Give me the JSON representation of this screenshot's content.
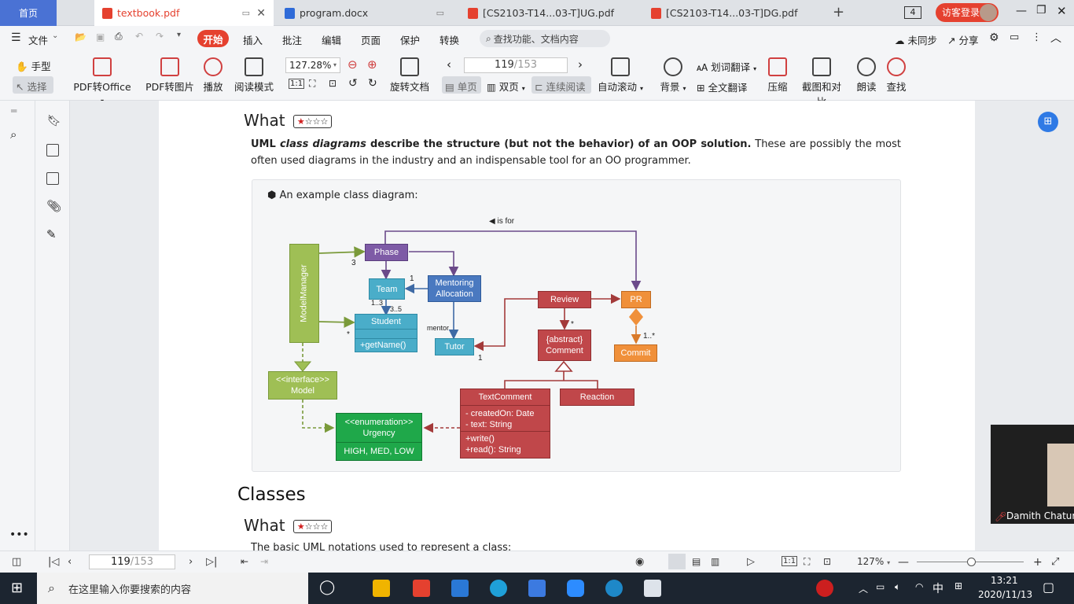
{
  "tabs": {
    "home": "首页",
    "docs": [
      {
        "label": "textbook.pdf",
        "color": "#e5412f"
      },
      {
        "label": "program.docx",
        "color": "#2f6bd8"
      },
      {
        "label": "[CS2103-T14...03-T]UG.pdf",
        "color": "#e5412f"
      },
      {
        "label": "[CS2103-T14...03-T]DG.pdf",
        "color": "#e5412f"
      }
    ],
    "tab_count": "4",
    "login": "访客登录"
  },
  "menu": {
    "file": "文件",
    "items": [
      "开始",
      "插入",
      "批注",
      "编辑",
      "页面",
      "保护",
      "转换"
    ],
    "search_placeholder": "查找功能、文档内容",
    "sync": "未同步",
    "share": "分享"
  },
  "ribbon": {
    "hand": "手型",
    "select": "选择",
    "pdf_office": "PDF转Office",
    "pdf_image": "PDF转图片",
    "play": "播放",
    "read_mode": "阅读模式",
    "zoom": "127.28%",
    "page_current": "119",
    "page_total": "153",
    "rotate": "旋转文档",
    "single": "单页",
    "double": "双页",
    "continuous": "连续阅读",
    "autoscroll": "自动滚动",
    "background": "背景",
    "word_translate": "划词翻译",
    "full_translate": "全文翻译",
    "compress": "压缩",
    "screenshot_compare": "截图和对比",
    "read_aloud": "朗读",
    "find": "查找"
  },
  "document": {
    "what1": "What",
    "para_bold1": "UML ",
    "para_bold_italic": "class diagrams",
    "para_bold2": " describe the structure (but not the behavior) of an OOP solution.",
    "para_rest": " These are possibly the most often used diagrams in the industry and an indispensable tool for an OO programmer.",
    "example_caption": "An example class diagram:",
    "classes_heading": "Classes",
    "what2": "What",
    "cut_line": "The basic UML notations used to represent a class:",
    "stars": "★☆☆☆"
  },
  "diagram": {
    "is_for": "◀ is for",
    "model_manager": "ModelManager",
    "phase": "Phase",
    "team": "Team",
    "mentoring_allocation": "Mentoring Allocation",
    "student": "Student",
    "student_op": "+getName()",
    "tutor": "Tutor",
    "review": "Review",
    "pr": "PR",
    "abstract_comment": "{abstract} Comment",
    "commit": "Commit",
    "interface_model": "<<interface>> Model",
    "enumeration_urgency": "<<enumeration>> Urgency",
    "urgency_values": "HIGH, MED, LOW",
    "text_comment": "TextComment",
    "text_comment_attr1": "- createdOn: Date",
    "text_comment_attr2": "- text: String",
    "text_comment_op1": "+write()",
    "text_comment_op2": "+read(): String",
    "reaction": "Reaction",
    "mult_3": "3",
    "mult_1a": "1",
    "mult_1_3": "1..3",
    "mult_3_5": "3..5",
    "mult_star_student": "*",
    "mentor": "mentor",
    "mult_1b": "1",
    "mult_star_comment": "*",
    "mult_1_star": "1..*"
  },
  "status": {
    "page_current": "119",
    "page_total": "153",
    "zoom": "127%"
  },
  "taskbar": {
    "search": "在这里输入你要搜索的内容",
    "time": "13:21",
    "date": "2020/11/13",
    "ime": "中"
  },
  "video": {
    "name": "Damith Chatura"
  }
}
